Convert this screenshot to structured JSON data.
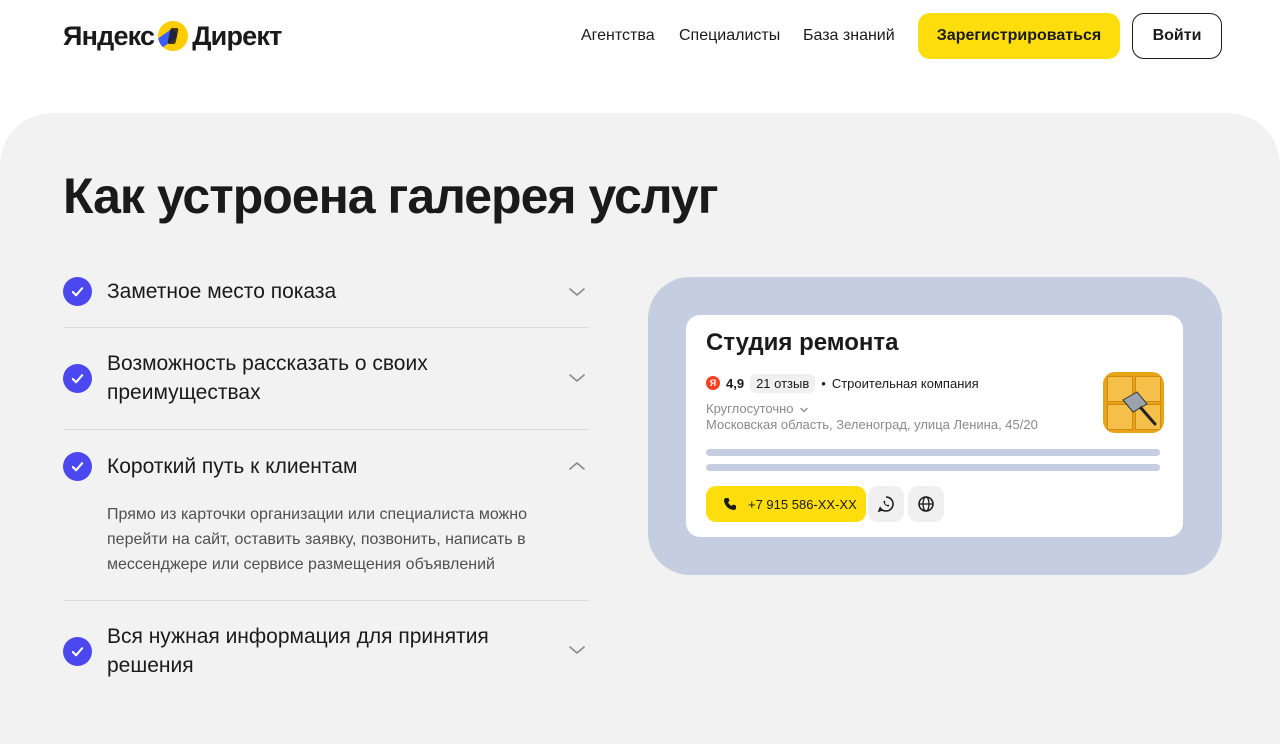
{
  "header": {
    "logo_left": "Яндекс",
    "logo_right": "Директ",
    "nav": [
      "Агентства",
      "Специалисты",
      "База знаний"
    ],
    "register_label": "Зарегистрироваться",
    "login_label": "Войти"
  },
  "main": {
    "title": "Как устроена галерея услуг",
    "accordion": [
      {
        "title": "Заметное место показа",
        "expanded": false
      },
      {
        "title": "Возможность рассказать о своих преимуществах",
        "expanded": false
      },
      {
        "title": "Короткий путь к клиентам",
        "expanded": true,
        "body": "Прямо из карточки организации или специалиста можно перейти на сайт, оставить заявку, позвонить, написать в мессенджере или сервисе размещения объявлений"
      },
      {
        "title": "Вся нужная информация для принятия решения",
        "expanded": false
      }
    ]
  },
  "card": {
    "title": "Студия ремонта",
    "ya_badge": "Я",
    "rating": "4,9",
    "reviews": "21 отзыв",
    "category": "Строительная компания",
    "hours": "Круглосуточно",
    "address": "Московская область, Зеленоград, улица Ленина, 45/20",
    "phone": "+7 915 586-XX-XX"
  },
  "colors": {
    "accent_yellow": "#fddd0b",
    "check_blue": "#4b48f0",
    "panel_bg": "#f2f2f2",
    "illustration_bg": "#c5cde0"
  },
  "icons": {
    "accordion_collapsed": "chevron-down-icon",
    "accordion_expanded": "chevron-up-icon",
    "item_marker": "check-circle-icon",
    "card_buttons": [
      "phone-icon",
      "whatsapp-icon",
      "globe-icon"
    ]
  }
}
